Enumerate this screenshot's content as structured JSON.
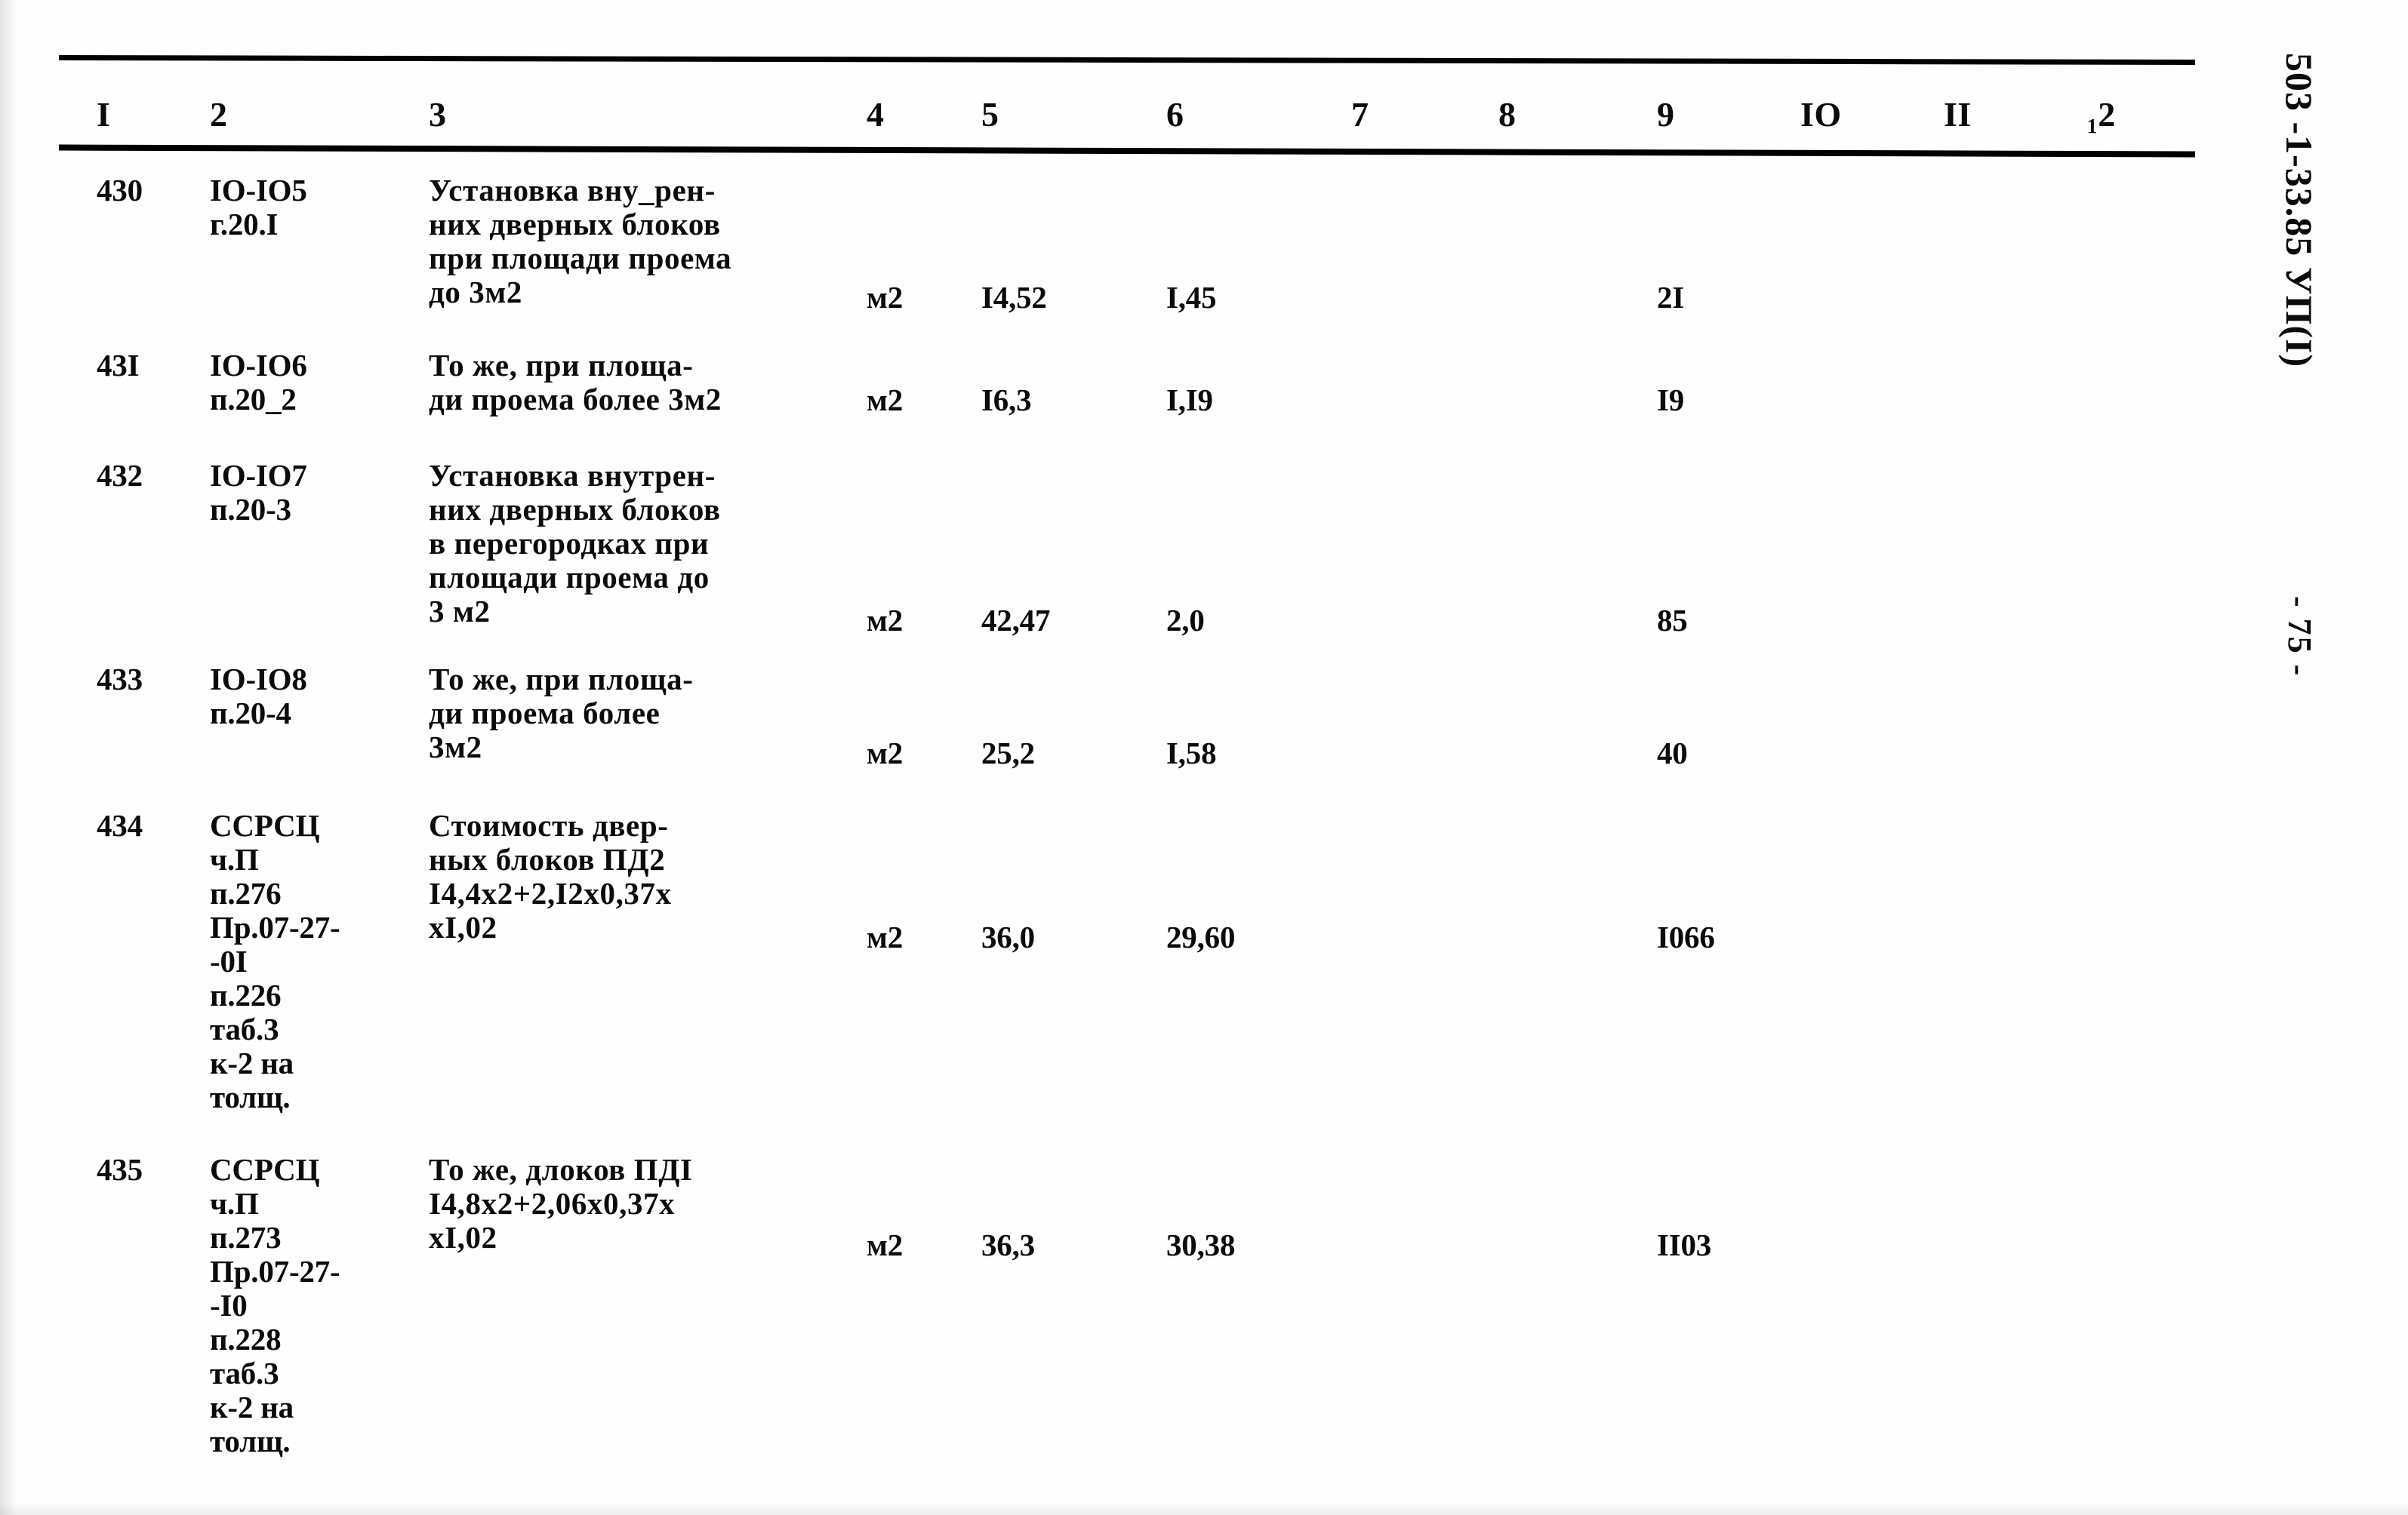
{
  "document": {
    "vertical_code": "503 -1-33.85 УП(I)",
    "page_marker": "- 75 -"
  },
  "table": {
    "headers": [
      "I",
      "2",
      "3",
      "4",
      "5",
      "6",
      "7",
      "8",
      "9",
      "IO",
      "II",
      "₁2"
    ],
    "rows": [
      {
        "no": "430",
        "code": "IO-IO5\nг.20.I",
        "description": "Установка вну_рен-\nних дверных блоков\nпри площади проема\nдо 3м2",
        "unit": "м2",
        "c5": "I4,52",
        "c6": "I,45",
        "c7": "",
        "c8": "",
        "c9": "2I",
        "c10": "",
        "c11": "",
        "c12": ""
      },
      {
        "no": "43I",
        "code": "IO-IO6\nп.20_2",
        "description": "То же, при площа-\nди проема более 3м2",
        "unit": "м2",
        "c5": "I6,3",
        "c6": "I,I9",
        "c7": "",
        "c8": "",
        "c9": "I9",
        "c10": "",
        "c11": "",
        "c12": ""
      },
      {
        "no": "432",
        "code": "IO-IO7\nп.20-3",
        "description": "Установка внутрен-\nних дверных блоков\nв перегородках при\nплощади проема до\n3 м2",
        "unit": "м2",
        "c5": "42,47",
        "c6": "2,0",
        "c7": "",
        "c8": "",
        "c9": "85",
        "c10": "",
        "c11": "",
        "c12": ""
      },
      {
        "no": "433",
        "code": "IO-IO8\nп.20-4",
        "description": "То же, при площа-\nди проема более\n3м2",
        "unit": "м2",
        "c5": "25,2",
        "c6": "I,58",
        "c7": "",
        "c8": "",
        "c9": "40",
        "c10": "",
        "c11": "",
        "c12": ""
      },
      {
        "no": "434",
        "code": "ССРСЦ\nч.П\nп.276\nПр.07-27-\n-0I\nп.226\nтаб.3\nк-2 на\nтолщ.",
        "description": "Стоимость двер-\nных блоков ПД2\nI4,4х2+2,I2х0,37х\nхI,02",
        "unit": "м2",
        "c5": "36,0",
        "c6": "29,60",
        "c7": "",
        "c8": "",
        "c9": "I066",
        "c10": "",
        "c11": "",
        "c12": ""
      },
      {
        "no": "435",
        "code": "ССРСЦ\nч.П\nп.273\nПр.07-27-\n-I0\nп.228\nтаб.3\nк-2 на\nтолщ.",
        "description": "То же, длоков ПДI\nI4,8х2+2,06х0,37х\nхI,02",
        "unit": "м2",
        "c5": "36,3",
        "c6": "30,38",
        "c7": "",
        "c8": "",
        "c9": "II03",
        "c10": "",
        "c11": "",
        "c12": ""
      }
    ]
  }
}
